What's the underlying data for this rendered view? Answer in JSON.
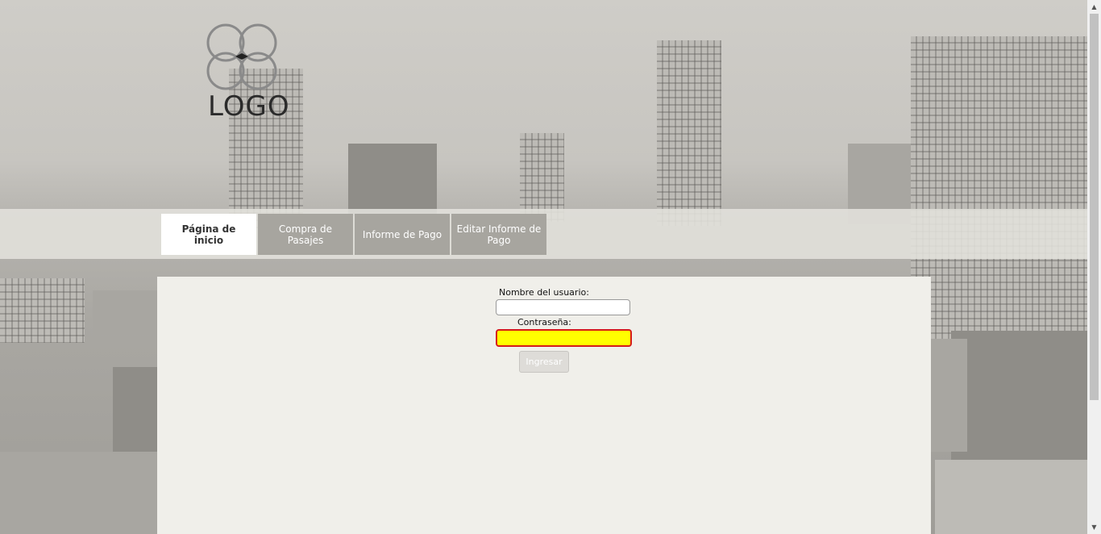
{
  "logo": {
    "text": "LOGO"
  },
  "nav": {
    "tabs": [
      {
        "label": "Página de inicio",
        "active": true
      },
      {
        "label": "Compra de Pasajes",
        "active": false
      },
      {
        "label": "Informe de Pago",
        "active": false
      },
      {
        "label": "Editar Informe de Pago",
        "active": false
      }
    ]
  },
  "form": {
    "username_label": "Nombre del usuario:",
    "username_value": "",
    "password_label": "Contraseña:",
    "password_value": "",
    "submit_label": "Ingresar"
  },
  "colors": {
    "error_field_bg": "#ffff00",
    "error_field_border": "#d61b1b",
    "tab_bg": "#a7a59f",
    "panel_bg": "#f0efea"
  }
}
